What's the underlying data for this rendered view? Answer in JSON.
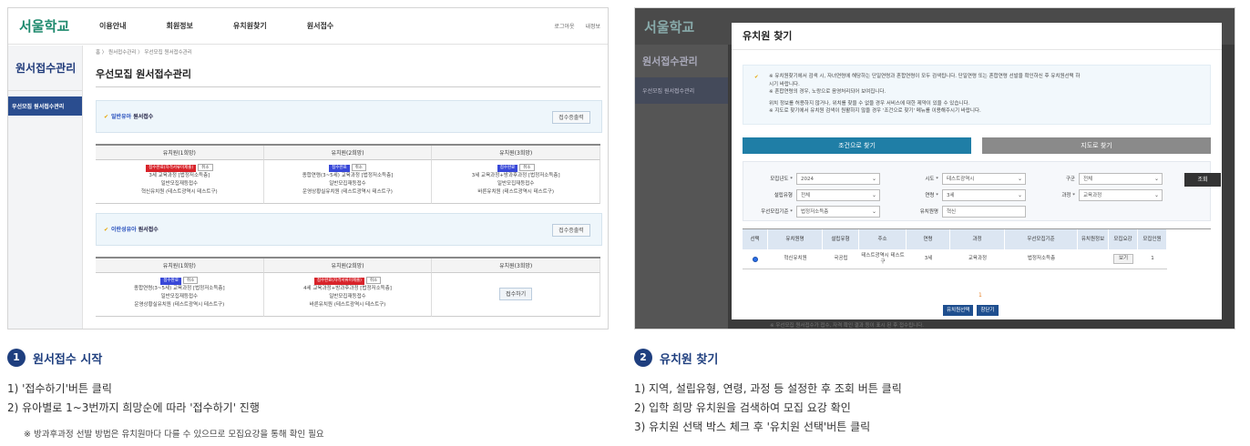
{
  "left": {
    "logo": "서울학교",
    "menu": [
      "이용안내",
      "회원정보",
      "유치원찾기",
      "원서접수"
    ],
    "util": [
      "로그아웃",
      "내정보"
    ],
    "side_title": "원서접수관리",
    "side_item": "우선모집 원서접수관리",
    "breadcrumb": "홈 〉 원서접수관리 〉 우선모집 원서접수관리",
    "page_title": "우선모집 원서접수관리",
    "general": {
      "label_pre": "일반유아",
      "label_post": "원서접수",
      "print": "접수증출력",
      "headers": [
        "유치원(1희망)",
        "유치원(2희망)",
        "유치원(3희망)"
      ],
      "cells": [
        {
          "tag": "접수완료(자격서류미제출)",
          "tag_color": "red",
          "cancel": "취소",
          "l1": "3세 교육과정 [법정저소득층]",
          "l2": "일반모집재등접수",
          "l3": "혁신유치원 (테스트광역시 테스트구)"
        },
        {
          "tag": "접수완료",
          "tag_color": "blue",
          "cancel": "취소",
          "l1": "종합연령(3~5세) 교육과정 [법정저소득층]",
          "l2": "일반모집재등접수",
          "l3": "운영상황실유치원 (테스트광역시 테스트구)"
        },
        {
          "tag": "접수완료",
          "tag_color": "blue",
          "cancel": "취소",
          "l1": "3세 교육과정+방과후과정 [법정저소득층]",
          "l2": "일반모집재등접수",
          "l3": "바른유치원 (테스트광역시 테스트구)"
        }
      ]
    },
    "twin": {
      "label_pre": "이란성유아",
      "label_post": "원서접수",
      "print": "접수증출력",
      "headers": [
        "유치원(1희망)",
        "유치원(2희망)",
        "유치원(3희망)"
      ],
      "cells": [
        {
          "tag": "접수완료",
          "tag_color": "blue",
          "cancel": "취소",
          "l1": "종합연령(3~5세) 교육과정 [법정저소득층]",
          "l2": "일반모집재등접수",
          "l3": "운영상황실유치원 (테스트광역시 테스트구)"
        },
        {
          "tag": "접수완료(자격서류미제출)",
          "tag_color": "red",
          "cancel": "취소",
          "l1": "4세 교육과정+방과후과정 [법정저소득층]",
          "l2": "일반모집재등접수",
          "l3": "바른유치원 (테스트광역시 테스트구)"
        }
      ],
      "apply": "접수하기"
    }
  },
  "right": {
    "bg_logo": "서울학교",
    "bg_side_title": "원서접수관리",
    "bg_side_item": "우선모집 원서접수관리",
    "bg_foot": "※ 우선모집 원서접수가 접수, 자격 확인 결과 등이 표시 된 후 접수됩니다.",
    "modal_title": "유치원 찾기",
    "notice": [
      "※ 유치원찾기에서 검색 시, 자녀연령에 해당하는 단일연령과 혼합연령이 모두 검색됩니다. 단일연령 또는 혼합연령 선발을 확인하신 후 유치원선택 하",
      "시기 바랍니다.",
      "※ 혼합연령의 경우, 노랑으로 음영처리되어 보여집니다.",
      "위치 정보를 허용하지 않거나, 위치를 찾을 수 없을 경우 서비스에 대한 제약이 있을 수 있습니다.",
      "※ 지도로 찾기에서 유치원 검색이 원활하지 않을 경우 '조건으로 찾기' 메뉴를 이용해주시기 바랍니다."
    ],
    "tab_condition": "조건으로 찾기",
    "tab_map": "지도로 찾기",
    "filters": {
      "year_label": "모집년도 *",
      "year": "2024",
      "sido_label": "시도 *",
      "sido": "테스트광역시",
      "gugun_label": "구군",
      "gugun": "전체",
      "type_label": "설립유형",
      "type": "전체",
      "age_label": "연령 *",
      "age": "3세",
      "course_label": "과정 *",
      "course": "교육과정",
      "priority_label": "우선모집기준 *",
      "priority": "법정저소득층",
      "name_label": "유치원명",
      "name": "혁신",
      "search": "조회"
    },
    "headers": [
      "선택",
      "유치원명",
      "설립유형",
      "주소",
      "연령",
      "과정",
      "우선모집기준",
      "유치원정보",
      "모집요강",
      "모집인원"
    ],
    "row": {
      "name": "혁신유치원",
      "type": "국공립",
      "addr": "테스트광역시 테스트구",
      "age": "3세",
      "course": "교육과정",
      "priority": "법정저소득층",
      "info": "",
      "view": "보기",
      "count": "1"
    },
    "page": "1",
    "btn_select": "유치원선택",
    "btn_close": "창닫기"
  },
  "captions": {
    "step1_num": "1",
    "step1_title": "원서접수 시작",
    "step1_lines": [
      "1) '접수하기'버튼 클릭",
      "2) 유아별로 1~3번까지 희망순에 따라 '접수하기' 진행"
    ],
    "step1_note": "※ 방과후과정 선발 방법은 유치원마다 다를 수 있으므로 모집요강을 통해 확인 필요",
    "step2_num": "2",
    "step2_title": "유치원 찾기",
    "step2_lines": [
      "1) 지역, 설립유형, 연령, 과정 등 설정한 후 조회 버튼 클릭",
      "2) 입학 희망 유치원을 검색하여 모집 요강 확인",
      "3) 유치원 선택 박스 체크 후 '유치원 선택'버튼 클릭"
    ]
  },
  "colors": {
    "navy": "#1f3f7f",
    "teal": "#1f7ea6",
    "red_tag": "#d8232a",
    "blue_tag": "#3848d8"
  }
}
